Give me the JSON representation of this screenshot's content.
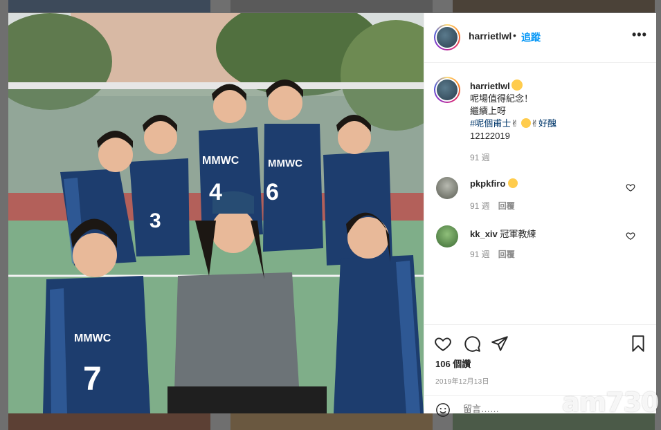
{
  "post": {
    "username": "harrietlwl",
    "separator": "•",
    "follow_label": "追蹤",
    "more_label": "•••"
  },
  "caption": {
    "username": "harrietlwl",
    "lines": [
      "呢場值得紀念！",
      "繼續上呀"
    ],
    "hashtag": "#呢個甫士",
    "hashtag_suffix": "好醜",
    "date_code": "12122019",
    "time_ago": "91 週"
  },
  "comments": [
    {
      "username": "pkpkfiro",
      "text": "",
      "time_ago": "91 週",
      "reply_label": "回覆"
    },
    {
      "username": "kk_xiv",
      "text": "冠軍教練",
      "time_ago": "91 週",
      "reply_label": "回覆"
    }
  ],
  "actions": {
    "likes_text": "106 個讚",
    "date_text": "2019年12月13日"
  },
  "comment_box": {
    "placeholder": "留言……"
  },
  "watermark": "am730",
  "photo": {
    "jersey_text": "MMWC",
    "numbers": [
      "4",
      "6",
      "3",
      "7"
    ]
  }
}
